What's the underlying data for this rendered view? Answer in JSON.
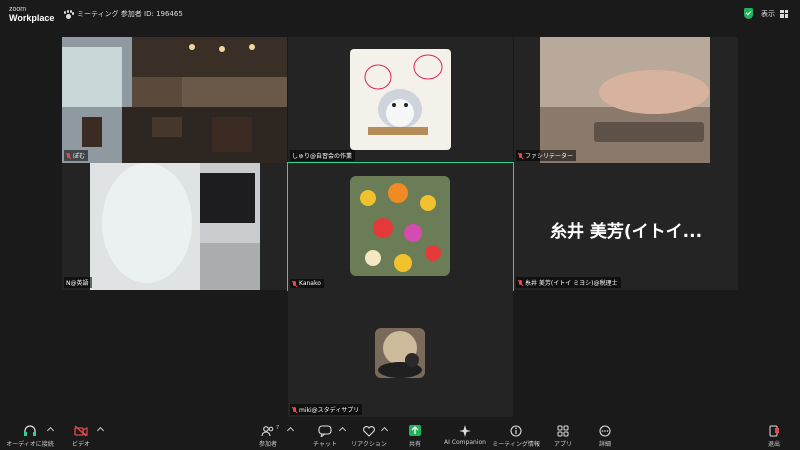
{
  "app": {
    "logo_line1": "zoom",
    "logo_line2": "Workplace"
  },
  "meeting": {
    "info": "ミーティング 参加者 ID: 196465"
  },
  "top_right": {
    "view_label": "表示"
  },
  "tiles": [
    {
      "name": "ぽむ",
      "muted": true
    },
    {
      "name": "しゅり@自習会の作業",
      "muted": false
    },
    {
      "name": "ファシリテーター",
      "muted": true
    },
    {
      "name": "N@英語",
      "muted": false
    },
    {
      "name": "Kanako",
      "muted": true,
      "active": true
    },
    {
      "name": "糸井 美芳(イトイ ミヨシ)@税理士",
      "display_big": "糸井 美芳(イトイ...",
      "muted": true
    },
    {
      "name": "miki@スタディサプリ",
      "muted": true
    }
  ],
  "toolbar": {
    "audio": "オーディオに接続",
    "video": "ビデオ",
    "participants": "参加者",
    "participants_count": "7",
    "chat": "チャット",
    "reactions": "リアクション",
    "share": "共有",
    "ai": "AI Companion",
    "info": "ミーティング情報",
    "apps": "アプリ",
    "more": "詳細",
    "leave": "退出"
  },
  "colors": {
    "active_border": "#2fd28a",
    "share_green": "#22b35a",
    "mute_red": "#e14b4b",
    "leave_red": "#e14b4b"
  }
}
